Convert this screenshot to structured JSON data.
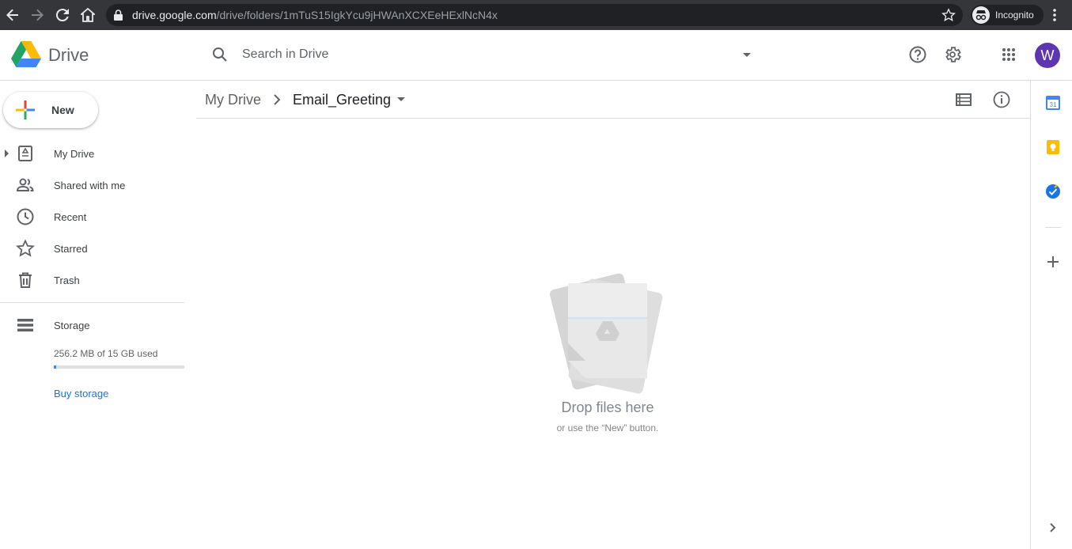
{
  "browser": {
    "url_host": "drive.google.com",
    "url_path": "/drive/folders/1mTuS15IgkYcu9jHWAnXCXEeHExlNcN4x",
    "incognito_label": "Incognito"
  },
  "header": {
    "app_name": "Drive",
    "search_placeholder": "Search in Drive",
    "avatar_initial": "W",
    "avatar_color": "#5e35b1"
  },
  "sidebar": {
    "new_label": "New",
    "items": [
      {
        "label": "My Drive",
        "icon": "my-drive-icon"
      },
      {
        "label": "Shared with me",
        "icon": "shared-icon"
      },
      {
        "label": "Recent",
        "icon": "clock-icon"
      },
      {
        "label": "Starred",
        "icon": "star-icon"
      },
      {
        "label": "Trash",
        "icon": "trash-icon"
      }
    ],
    "storage": {
      "label": "Storage",
      "used_text": "256.2 MB of 15 GB used",
      "used_fraction": 0.017,
      "buy_label": "Buy storage"
    }
  },
  "breadcrumb": {
    "root": "My Drive",
    "current": "Email_Greeting"
  },
  "empty_state": {
    "title": "Drop files here",
    "subtitle": "or use the “New” button."
  },
  "side_panel": {
    "calendar_day": "31",
    "icons": [
      "calendar-icon",
      "keep-icon",
      "tasks-icon",
      "add-addon-icon",
      "expand-panel-icon"
    ]
  },
  "colors": {
    "accent": "#1a73e8",
    "chrome_bg": "#35363a",
    "storage_fill": "#4285f4"
  }
}
